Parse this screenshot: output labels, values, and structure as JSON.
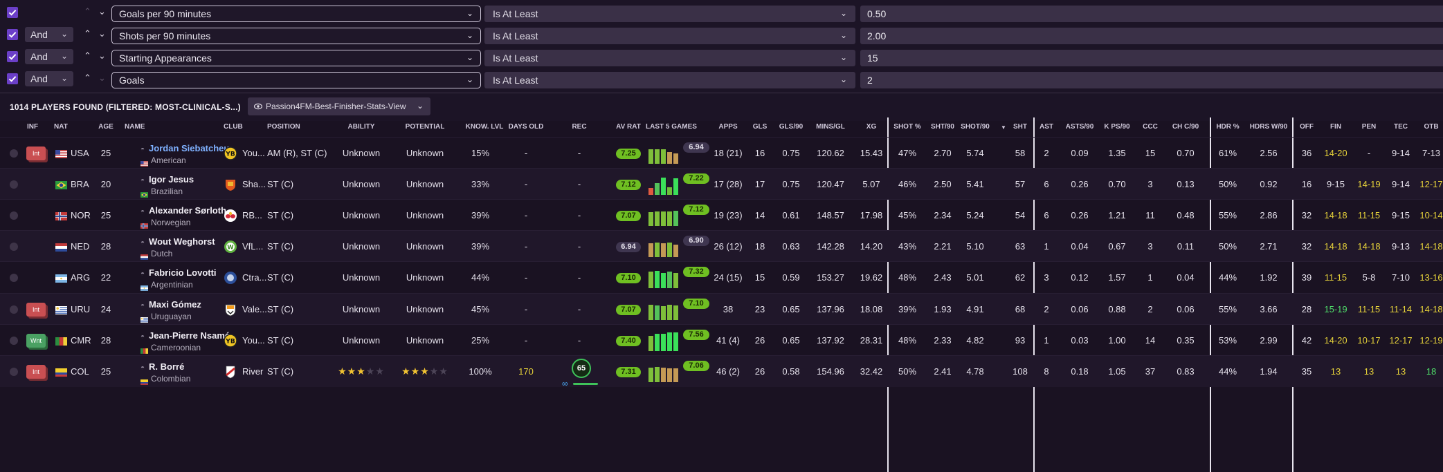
{
  "filters": [
    {
      "join": "",
      "field": "Goals per 90 minutes",
      "operator": "Is At Least",
      "value": "0.50"
    },
    {
      "join": "And",
      "field": "Shots per 90 minutes",
      "operator": "Is At Least",
      "value": "2.00"
    },
    {
      "join": "And",
      "field": "Starting Appearances",
      "operator": "Is At Least",
      "value": "15"
    },
    {
      "join": "And",
      "field": "Goals",
      "operator": "Is At Least",
      "value": "2"
    }
  ],
  "results": {
    "count_label": "1014 PLAYERS FOUND (FILTERED: MOST-CLINICAL-S...)",
    "view": "Passion4FM-Best-Finisher-Stats-View"
  },
  "columns": {
    "inf": "INF",
    "nat": "NAT",
    "age": "AGE",
    "name": "NAME",
    "club": "CLUB",
    "position": "POSITION",
    "ability": "ABILITY",
    "potential": "POTENTIAL",
    "know": "KNOW. LVL",
    "days": "DAYS OLD",
    "rec": "REC",
    "avrat": "AV RAT",
    "last5": "LAST 5 GAMES",
    "apps": "APPS",
    "gls": "GLS",
    "gls90": "GLS/90",
    "mins": "MINS/GL",
    "xg": "XG",
    "shotpct": "SHOT %",
    "sht90": "SHT/90",
    "shot90": "SHOT/90",
    "sort_icon": "▼",
    "sht": "SHT",
    "ast": "AST",
    "asts90": "ASTS/90",
    "kps90": "K PS/90",
    "ccc": "CCC",
    "chc90": "CH C/90",
    "hdr": "HDR %",
    "hdrsw90": "HDRS W/90",
    "off": "OFF",
    "fin": "FIN",
    "pen": "PEN",
    "tec": "TEC",
    "otb": "OTB"
  },
  "colors": {
    "accent": "#6b3fc8",
    "rating_green": "#6fbf22",
    "attr_yellow": "#e7d33a",
    "attr_green": "#4fe06a"
  },
  "players": [
    {
      "inf": "Int",
      "nat": "USA",
      "age": "25",
      "name": "Jordan Siebatcheu",
      "nationality": "American",
      "club": "You...",
      "position": "AM (R), ST (C)",
      "ability": "Unknown",
      "potential": "Unknown",
      "know": "15%",
      "days": "-",
      "rec": "-",
      "avrat": "7.25",
      "best": "6.94",
      "apps": "18 (21)",
      "gls": "16",
      "gls90": "0.75",
      "mins": "120.62",
      "xg": "15.43",
      "shotpct": "47%",
      "sht90": "2.70",
      "shot90": "5.74",
      "sht": "58",
      "ast": "2",
      "asts90": "0.09",
      "kps90": "1.35",
      "ccc": "15",
      "chc90": "0.70",
      "hdr": "61%",
      "hdrsw90": "2.56",
      "off": "36",
      "fin": "14-20",
      "pen": "-",
      "tec": "9-14",
      "otb": "7-13"
    },
    {
      "inf": "",
      "nat": "BRA",
      "age": "20",
      "name": "Igor Jesus",
      "nationality": "Brazilian",
      "club": "Sha...",
      "position": "ST (C)",
      "ability": "Unknown",
      "potential": "Unknown",
      "know": "33%",
      "days": "-",
      "rec": "-",
      "avrat": "7.12",
      "best": "7.22",
      "apps": "17 (28)",
      "gls": "17",
      "gls90": "0.75",
      "mins": "120.47",
      "xg": "5.07",
      "shotpct": "46%",
      "sht90": "2.50",
      "shot90": "5.41",
      "sht": "57",
      "ast": "6",
      "asts90": "0.26",
      "kps90": "0.70",
      "ccc": "3",
      "chc90": "0.13",
      "hdr": "50%",
      "hdrsw90": "0.92",
      "off": "16",
      "fin": "9-15",
      "pen": "14-19",
      "tec": "9-14",
      "otb": "12-17"
    },
    {
      "inf": "",
      "nat": "NOR",
      "age": "25",
      "name": "Alexander Sørloth",
      "nationality": "Norwegian",
      "club": "RB...",
      "position": "ST (C)",
      "ability": "Unknown",
      "potential": "Unknown",
      "know": "39%",
      "days": "-",
      "rec": "-",
      "avrat": "7.07",
      "best": "7.12",
      "apps": "19 (23)",
      "gls": "14",
      "gls90": "0.61",
      "mins": "148.57",
      "xg": "17.98",
      "shotpct": "45%",
      "sht90": "2.34",
      "shot90": "5.24",
      "sht": "54",
      "ast": "6",
      "asts90": "0.26",
      "kps90": "1.21",
      "ccc": "11",
      "chc90": "0.48",
      "hdr": "55%",
      "hdrsw90": "2.86",
      "off": "32",
      "fin": "14-18",
      "pen": "11-15",
      "tec": "9-15",
      "otb": "10-14"
    },
    {
      "inf": "",
      "nat": "NED",
      "age": "28",
      "name": "Wout Weghorst",
      "nationality": "Dutch",
      "club": "VfL...",
      "position": "ST (C)",
      "ability": "Unknown",
      "potential": "Unknown",
      "know": "39%",
      "days": "-",
      "rec": "-",
      "avrat": "6.94",
      "best": "6.90",
      "apps": "26 (12)",
      "gls": "18",
      "gls90": "0.63",
      "mins": "142.28",
      "xg": "14.20",
      "shotpct": "43%",
      "sht90": "2.21",
      "shot90": "5.10",
      "sht": "63",
      "ast": "1",
      "asts90": "0.04",
      "kps90": "0.67",
      "ccc": "3",
      "chc90": "0.11",
      "hdr": "50%",
      "hdrsw90": "2.71",
      "off": "32",
      "fin": "14-18",
      "pen": "14-18",
      "tec": "9-13",
      "otb": "14-18"
    },
    {
      "inf": "",
      "nat": "ARG",
      "age": "22",
      "name": "Fabricio Lovotti",
      "nationality": "Argentinian",
      "club": "Ctra...",
      "position": "ST (C)",
      "ability": "Unknown",
      "potential": "Unknown",
      "know": "44%",
      "days": "-",
      "rec": "-",
      "avrat": "7.10",
      "best": "7.32",
      "apps": "24 (15)",
      "gls": "15",
      "gls90": "0.59",
      "mins": "153.27",
      "xg": "19.62",
      "shotpct": "48%",
      "sht90": "2.43",
      "shot90": "5.01",
      "sht": "62",
      "ast": "3",
      "asts90": "0.12",
      "kps90": "1.57",
      "ccc": "1",
      "chc90": "0.04",
      "hdr": "44%",
      "hdrsw90": "1.92",
      "off": "39",
      "fin": "11-15",
      "pen": "5-8",
      "tec": "7-10",
      "otb": "13-16"
    },
    {
      "inf": "Int",
      "nat": "URU",
      "age": "24",
      "name": "Maxi Gómez",
      "nationality": "Uruguayan",
      "club": "Vale...",
      "position": "ST (C)",
      "ability": "Unknown",
      "potential": "Unknown",
      "know": "45%",
      "days": "-",
      "rec": "-",
      "avrat": "7.07",
      "best": "7.10",
      "apps": "38",
      "gls": "23",
      "gls90": "0.65",
      "mins": "137.96",
      "xg": "18.08",
      "shotpct": "39%",
      "sht90": "1.93",
      "shot90": "4.91",
      "sht": "68",
      "ast": "2",
      "asts90": "0.06",
      "kps90": "0.88",
      "ccc": "2",
      "chc90": "0.06",
      "hdr": "55%",
      "hdrsw90": "3.66",
      "off": "28",
      "fin": "15-19",
      "pen": "11-15",
      "tec": "11-14",
      "otb": "14-18"
    },
    {
      "inf": "Wnt",
      "nat": "CMR",
      "age": "28",
      "name": "Jean-Pierre Nsamé",
      "nationality": "Cameroonian",
      "club": "You...",
      "position": "ST (C)",
      "ability": "Unknown",
      "potential": "Unknown",
      "know": "25%",
      "days": "-",
      "rec": "-",
      "avrat": "7.40",
      "best": "7.56",
      "apps": "41 (4)",
      "gls": "26",
      "gls90": "0.65",
      "mins": "137.92",
      "xg": "28.31",
      "shotpct": "48%",
      "sht90": "2.33",
      "shot90": "4.82",
      "sht": "93",
      "ast": "1",
      "asts90": "0.03",
      "kps90": "1.00",
      "ccc": "14",
      "chc90": "0.35",
      "hdr": "53%",
      "hdrsw90": "2.99",
      "off": "42",
      "fin": "14-20",
      "pen": "10-17",
      "tec": "12-17",
      "otb": "12-19"
    },
    {
      "inf": "Int",
      "nat": "COL",
      "age": "25",
      "name": "R. Borré",
      "nationality": "Colombian",
      "club": "River",
      "position": "ST (C)",
      "ability": "",
      "potential": "",
      "ability_stars": 3,
      "potential_stars": 3,
      "know": "100%",
      "days": "170",
      "rec": "65",
      "avrat": "7.31",
      "best": "7.06",
      "apps": "46 (2)",
      "gls": "26",
      "gls90": "0.58",
      "mins": "154.96",
      "xg": "32.42",
      "shotpct": "50%",
      "sht90": "2.41",
      "shot90": "4.78",
      "sht": "108",
      "ast": "8",
      "asts90": "0.18",
      "kps90": "1.05",
      "ccc": "37",
      "chc90": "0.83",
      "hdr": "44%",
      "hdrsw90": "1.94",
      "off": "35",
      "fin": "13",
      "pen": "13",
      "tec": "13",
      "otb": "18"
    }
  ]
}
